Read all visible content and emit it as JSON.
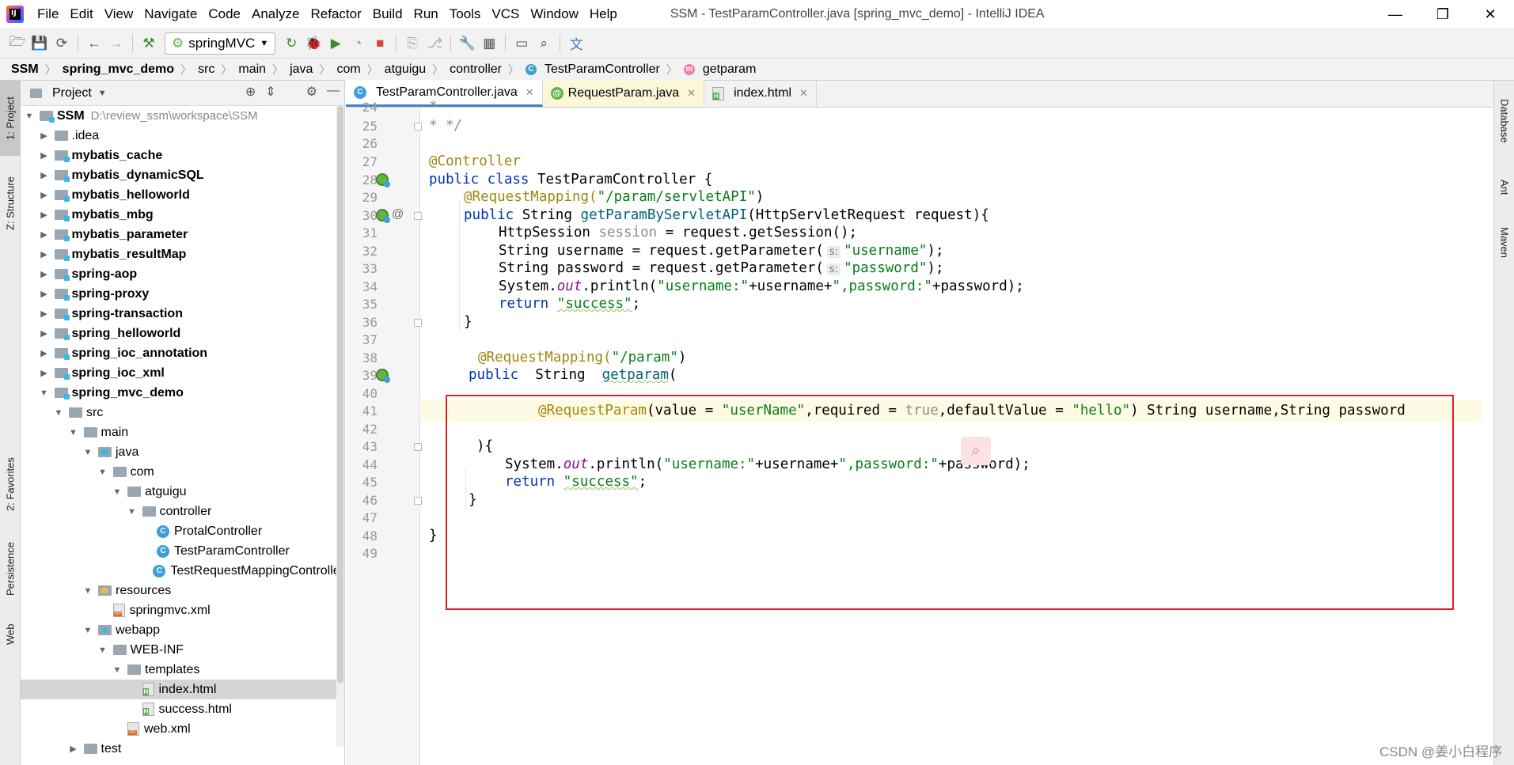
{
  "window": {
    "app_logo_text": "IJ",
    "title": "SSM - TestParamController.java [spring_mvc_demo] - IntelliJ IDEA",
    "menu": [
      "File",
      "Edit",
      "View",
      "Navigate",
      "Code",
      "Analyze",
      "Refactor",
      "Build",
      "Run",
      "Tools",
      "VCS",
      "Window",
      "Help"
    ]
  },
  "toolbar": {
    "run_config": "springMVC"
  },
  "breadcrumb": [
    "SSM",
    "spring_mvc_demo",
    "src",
    "main",
    "java",
    "com",
    "atguigu",
    "controller",
    "TestParamController",
    "getparam"
  ],
  "left_tabs": [
    "1: Project",
    "Z: Structure",
    "2: Favorites",
    "Persistence",
    "Web"
  ],
  "right_tabs": [
    "Database",
    "Ant",
    "Maven"
  ],
  "project_panel": {
    "title": "Project",
    "tree": [
      {
        "label": "SSM",
        "path": "D:\\review_ssm\\workspace\\SSM",
        "depth": 0,
        "expanded": true,
        "type": "module",
        "bold": true
      },
      {
        "label": ".idea",
        "depth": 1,
        "expanded": false,
        "type": "folder"
      },
      {
        "label": "mybatis_cache",
        "depth": 1,
        "expanded": false,
        "type": "module",
        "bold": true
      },
      {
        "label": "mybatis_dynamicSQL",
        "depth": 1,
        "expanded": false,
        "type": "module",
        "bold": true
      },
      {
        "label": "mybatis_helloworld",
        "depth": 1,
        "expanded": false,
        "type": "module",
        "bold": true
      },
      {
        "label": "mybatis_mbg",
        "depth": 1,
        "expanded": false,
        "type": "module",
        "bold": true
      },
      {
        "label": "mybatis_parameter",
        "depth": 1,
        "expanded": false,
        "type": "module",
        "bold": true
      },
      {
        "label": "mybatis_resultMap",
        "depth": 1,
        "expanded": false,
        "type": "module",
        "bold": true
      },
      {
        "label": "spring-aop",
        "depth": 1,
        "expanded": false,
        "type": "module",
        "bold": true
      },
      {
        "label": "spring-proxy",
        "depth": 1,
        "expanded": false,
        "type": "module",
        "bold": true
      },
      {
        "label": "spring-transaction",
        "depth": 1,
        "expanded": false,
        "type": "module",
        "bold": true
      },
      {
        "label": "spring_helloworld",
        "depth": 1,
        "expanded": false,
        "type": "module",
        "bold": true
      },
      {
        "label": "spring_ioc_annotation",
        "depth": 1,
        "expanded": false,
        "type": "module",
        "bold": true
      },
      {
        "label": "spring_ioc_xml",
        "depth": 1,
        "expanded": false,
        "type": "module",
        "bold": true
      },
      {
        "label": "spring_mvc_demo",
        "depth": 1,
        "expanded": true,
        "type": "module",
        "bold": true
      },
      {
        "label": "src",
        "depth": 2,
        "expanded": true,
        "type": "folder"
      },
      {
        "label": "main",
        "depth": 3,
        "expanded": true,
        "type": "folder"
      },
      {
        "label": "java",
        "depth": 4,
        "expanded": true,
        "type": "src"
      },
      {
        "label": "com",
        "depth": 5,
        "expanded": true,
        "type": "folder"
      },
      {
        "label": "atguigu",
        "depth": 6,
        "expanded": true,
        "type": "folder"
      },
      {
        "label": "controller",
        "depth": 7,
        "expanded": true,
        "type": "folder"
      },
      {
        "label": "ProtalController",
        "depth": 8,
        "type": "class"
      },
      {
        "label": "TestParamController",
        "depth": 8,
        "type": "class"
      },
      {
        "label": "TestRequestMappingController",
        "depth": 8,
        "type": "class"
      },
      {
        "label": "resources",
        "depth": 4,
        "expanded": true,
        "type": "res"
      },
      {
        "label": "springmvc.xml",
        "depth": 5,
        "type": "xml"
      },
      {
        "label": "webapp",
        "depth": 4,
        "expanded": true,
        "type": "web"
      },
      {
        "label": "WEB-INF",
        "depth": 5,
        "expanded": true,
        "type": "folder"
      },
      {
        "label": "templates",
        "depth": 6,
        "expanded": true,
        "type": "folder"
      },
      {
        "label": "index.html",
        "depth": 7,
        "type": "html",
        "selected": true
      },
      {
        "label": "success.html",
        "depth": 7,
        "type": "html"
      },
      {
        "label": "web.xml",
        "depth": 6,
        "type": "xml"
      },
      {
        "label": "test",
        "depth": 3,
        "expanded": false,
        "type": "folder"
      }
    ]
  },
  "tabs": [
    {
      "label": "TestParamController.java",
      "icon": "class",
      "active": true
    },
    {
      "label": "RequestParam.java",
      "icon": "annotation",
      "active": false
    },
    {
      "label": "index.html",
      "icon": "html",
      "active": false
    }
  ],
  "tab_icon_letters": {
    "class": "C",
    "annotation": "@"
  },
  "line_numbers": [
    "24",
    "25",
    "26",
    "27",
    "28",
    "29",
    "30",
    "31",
    "32",
    "33",
    "34",
    "35",
    "36",
    "37",
    "38",
    "39",
    "40",
    "41",
    "42",
    "43",
    "44",
    "45",
    "46",
    "47",
    "48",
    "49"
  ],
  "code": {
    "l24": "*",
    "l25": "* */",
    "l27": "@Controller",
    "l28_kw1": "public",
    "l28_kw2": "class",
    "l28_name": "TestParamController {",
    "l29_ann": "@RequestMapping(",
    "l29_str": "\"/param/servletAPI\"",
    "l29_end": ")",
    "l30_kw": "public",
    "l30_type": "String",
    "l30_fn": "getParamByServletAPI",
    "l30_rest": "(HttpServletRequest request){",
    "l31_a": "HttpSession",
    "l31_b": "session",
    "l31_c": "= request.getSession();",
    "l32_a": "String username = request.getParameter(",
    "l32_hint": "s:",
    "l32_str": "\"username\"",
    "l32_end": ");",
    "l33_a": "String password = request.getParameter(",
    "l33_hint": "s:",
    "l33_str": "\"password\"",
    "l33_end": ");",
    "l34_a": "System.",
    "l34_out": "out",
    "l34_b": ".println(",
    "l34_s1": "\"username:\"",
    "l34_c": "+username+",
    "l34_s2": "\",password:\"",
    "l34_d": "+password);",
    "l35_kw": "return",
    "l35_str": "\"success\"",
    "l35_end": ";",
    "l36": "}",
    "l38_ann": "@RequestMapping(",
    "l38_str": "\"/param\"",
    "l38_end": ")",
    "l39_kw": "public",
    "l39_type": "String",
    "l39_fn": "getparam",
    "l39_end": "(",
    "l41_ann": "@RequestParam",
    "l41_a": "(value = ",
    "l41_s1": "\"userName\"",
    "l41_b": ",required = ",
    "l41_kw": "true",
    "l41_c": ",defaultValue = ",
    "l41_s2": "\"hello\"",
    "l41_d": ") String username,String password",
    "l43": "){",
    "l44_a": "System.",
    "l44_out": "out",
    "l44_b": ".println(",
    "l44_s1": "\"username:\"",
    "l44_c": "+username+",
    "l44_s2": "\",password:\"",
    "l44_d": "+password);",
    "l45_kw": "return",
    "l45_str": "\"success\"",
    "l45_end": ";",
    "l46": "}",
    "l48": "}"
  },
  "watermark": "CSDN @姜小白程序",
  "colors": {
    "keyword": "#0033b3",
    "annotation": "#9e880d",
    "string": "#067d17",
    "highlight_box": "#e0202a"
  }
}
